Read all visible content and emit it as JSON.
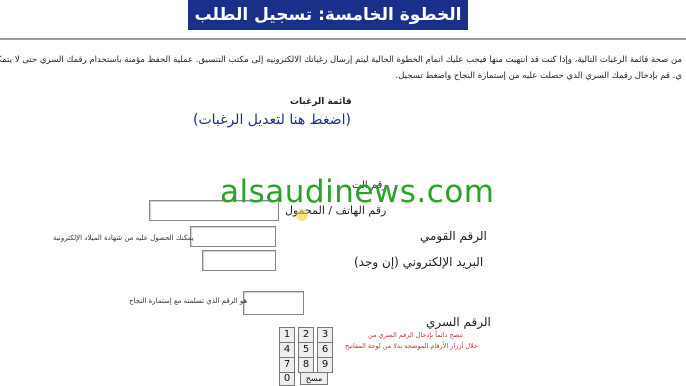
{
  "header": {
    "title": "الخطوة الخامسة: تسجيل الطلب"
  },
  "instructions": {
    "line1": "من صحة قائمة الرغبات التالية، وإذا كنت قد انتهيت منها فيجب عليك اتمام الخطوة الحالية ليتم إرسال رغباتك الالكترونيه إلى مكتب التنسيق. عملية الحفظ مؤمنة باستخدام رقمك السري حتى لا يتمكن أحد",
    "line2": "ي. قم بإدخال رقمك السري الذي حصلت عليه من إستمارة النجاح واضغط تسجيل."
  },
  "wishes": {
    "title": "قائمة الرغبات",
    "edit_link": "(اضغط هنا لتعديل الرغبات)"
  },
  "watermark": "alsaudinews.com",
  "form": {
    "phone_label_top": "رقم الت",
    "phone_label": "رقم الهاتف / المحمول",
    "national_id_label": "الرقم القومي",
    "national_id_hint": "يمكنك الحصول عليه من شهادة الميلاد الإلكترونية",
    "email_label": "البريد الإلكتروني (إن وجد)",
    "seat_hint": "هو الرقم الذي تسلمته مع إستمارة النجاح",
    "password_label": "الرقم السري",
    "password_warn1": "تنصح دائماً بإدخال الرقم السري من",
    "password_warn2": "خلال أزرار الأرقام الموضحه بدلا من لوحة المفاتيح",
    "phone_value": "",
    "national_id_value": "",
    "email_value": "",
    "seat_value": ""
  },
  "keypad": {
    "keys": [
      "1",
      "2",
      "3",
      "4",
      "5",
      "6",
      "7",
      "8",
      "9",
      "0"
    ],
    "clear_label": "مسح"
  }
}
